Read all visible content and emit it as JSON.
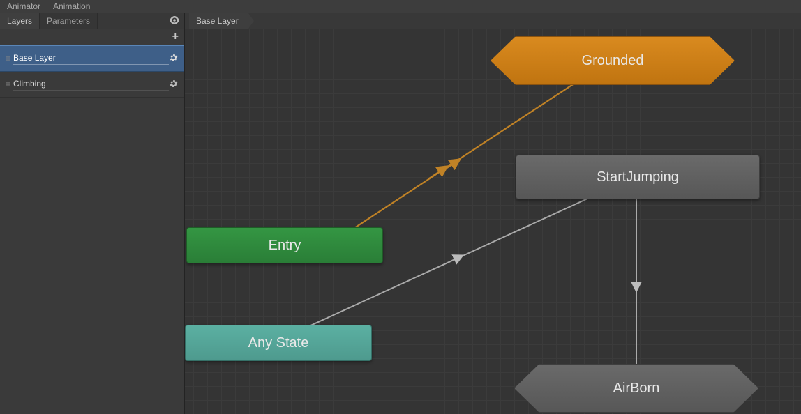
{
  "window": {
    "tab1": "Animator",
    "tab2": "Animation"
  },
  "header": {
    "tab_layers": "Layers",
    "tab_parameters": "Parameters",
    "breadcrumb": "Base Layer"
  },
  "sidebar": {
    "add": "+",
    "layers": [
      {
        "name": "Base Layer",
        "selected": true
      },
      {
        "name": "Climbing",
        "selected": false
      }
    ]
  },
  "nodes": {
    "entry": {
      "label": "Entry"
    },
    "anystate": {
      "label": "Any State"
    },
    "grounded": {
      "label": "Grounded"
    },
    "startjumping": {
      "label": "StartJumping"
    },
    "airborn": {
      "label": "AirBorn"
    }
  }
}
